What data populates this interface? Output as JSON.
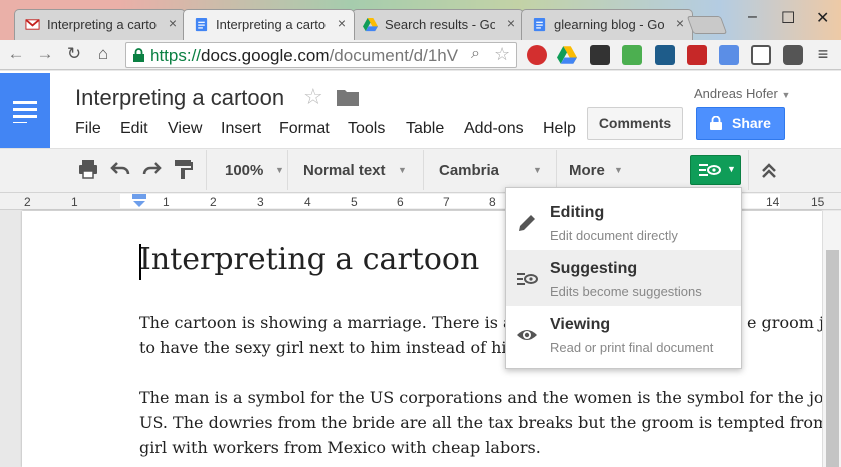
{
  "browser": {
    "tabs": [
      {
        "title": "Interpreting a cartoo",
        "favicon": "gmail-icon",
        "active": false
      },
      {
        "title": "Interpreting a cartoo",
        "favicon": "docs-icon",
        "active": true
      },
      {
        "title": "Search results - Goo",
        "favicon": "drive-icon",
        "active": false
      },
      {
        "title": "glearning blog - Goo",
        "favicon": "docs-icon",
        "active": false
      }
    ],
    "close_glyph": "×",
    "window": {
      "minimize": "–",
      "maximize": "☐",
      "close": "✕"
    },
    "url": {
      "scheme": "https://",
      "domain": "docs.google.com",
      "path": "/document/d/1hV"
    }
  },
  "docs": {
    "title": "Interpreting a cartoon",
    "menu": [
      "File",
      "Edit",
      "View",
      "Insert",
      "Format",
      "Tools",
      "Table",
      "Add-ons",
      "Help"
    ],
    "account": "Andreas Hofer",
    "comments_label": "Comments",
    "share_label": "Share",
    "toolbar": {
      "zoom": "100%",
      "style": "Normal text",
      "font": "Cambria",
      "more": "More"
    },
    "ruler_numbers": [
      "2",
      "1",
      "1",
      "2",
      "3",
      "4",
      "5",
      "6",
      "7",
      "8",
      "14",
      "15"
    ]
  },
  "document": {
    "heading": "Interpreting a cartoon",
    "paragraphs": [
      [
        "The cartoon is showing a marriage. There is a",
        "to have the sexy girl next to him instead of his"
      ],
      [
        "The man is a symbol for the US corporations and the women is the symbol for the job",
        "US. The dowries from the bride are all the tax breaks but the groom is tempted from",
        "girl with workers from Mexico with cheap labors."
      ]
    ],
    "hidden_tail": "e groom ju"
  },
  "mode_menu": {
    "items": [
      {
        "label": "Editing",
        "desc": "Edit document directly",
        "icon": "pencil-icon",
        "selected": false
      },
      {
        "label": "Suggesting",
        "desc": "Edits become suggestions",
        "icon": "suggest-icon",
        "selected": true
      },
      {
        "label": "Viewing",
        "desc": "Read or print final document",
        "icon": "eye-icon",
        "selected": false
      }
    ]
  },
  "colors": {
    "docs_blue": "#4285f4",
    "share_blue": "#4d90fe",
    "suggest_green": "#0f9d58",
    "secure_green": "#0b8043"
  }
}
